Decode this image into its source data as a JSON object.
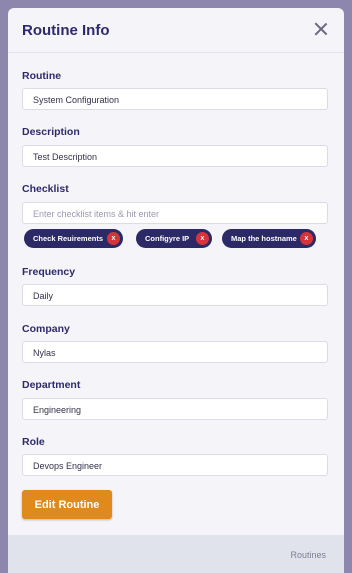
{
  "modal": {
    "title": "Routine Info",
    "close_icon": "close-icon"
  },
  "fields": {
    "routine": {
      "label": "Routine",
      "value": "System Configuration"
    },
    "description": {
      "label": "Description",
      "value": "Test Description"
    },
    "checklist": {
      "label": "Checklist",
      "placeholder": "Enter checklist items & hit enter",
      "items": [
        {
          "label": "Check Reuirements",
          "remove": "x"
        },
        {
          "label": "Configyre IP",
          "remove": "x"
        },
        {
          "label": "Map the hostname",
          "remove": "x"
        }
      ]
    },
    "frequency": {
      "label": "Frequency",
      "value": "Daily"
    },
    "company": {
      "label": "Company",
      "value": "Nylas"
    },
    "department": {
      "label": "Department",
      "value": "Engineering"
    },
    "role": {
      "label": "Role",
      "value": "Devops Engineer"
    }
  },
  "actions": {
    "edit_label": "Edit Routine"
  },
  "footer": {
    "link": "Routines"
  },
  "colors": {
    "overlay": "#8c84ad",
    "title": "#2f2a6b",
    "chip": "#2b2a66",
    "chip_remove": "#d6343a",
    "button": "#e08a1e"
  }
}
